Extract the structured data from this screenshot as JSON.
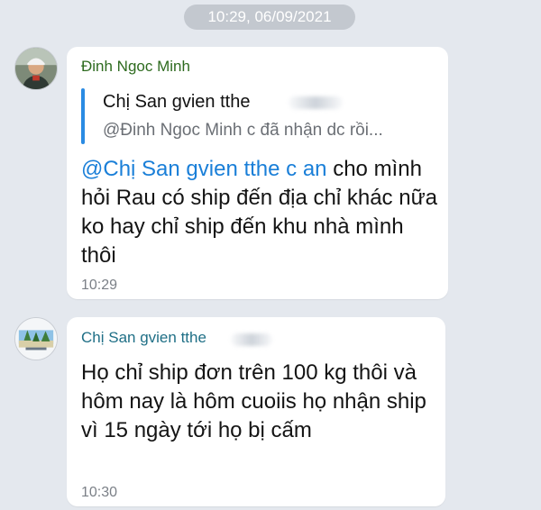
{
  "date_separator": "10:29, 06/09/2021",
  "messages": [
    {
      "sender": "Đinh Ngoc Minh",
      "reply": {
        "title": "Chị San gvien tthe",
        "text": "@Đinh Ngoc Minh c đã nhận dc rồi..."
      },
      "mention": "@Chị San gvien tthe c an",
      "text": " cho mình hỏi Rau có ship đến địa chỉ khác nữa ko hay chỉ ship đến khu nhà mình thôi",
      "time": "10:29"
    },
    {
      "sender": "Chị San gvien tthe",
      "text": "Họ chỉ ship đơn trên 100 kg thôi và hôm nay là hôm cuoiis họ nhận ship vì 15 ngày tới họ bị cấm",
      "time": "10:30"
    }
  ],
  "colors": {
    "background": "#e4e8ee",
    "mention": "#1a7fd8",
    "quote_bar": "#2a8be3",
    "sender1": "#2e6b1f",
    "sender2": "#1f6f86"
  },
  "icons": [
    "avatar-photo-person",
    "avatar-photo-beach"
  ]
}
